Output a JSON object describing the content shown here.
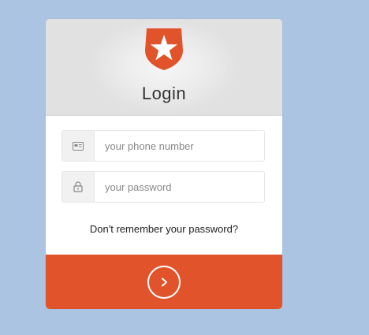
{
  "login": {
    "title": "Login",
    "phone_placeholder": "your phone number",
    "password_placeholder": "your password",
    "forgot_password": "Don't remember your password?",
    "logo_icon": "auth0-shield-star-icon",
    "phone_icon": "phone-card-icon",
    "password_icon": "lock-icon",
    "submit_icon": "chevron-right-icon"
  },
  "colors": {
    "background": "#abc4e1",
    "accent": "#e1532b"
  }
}
